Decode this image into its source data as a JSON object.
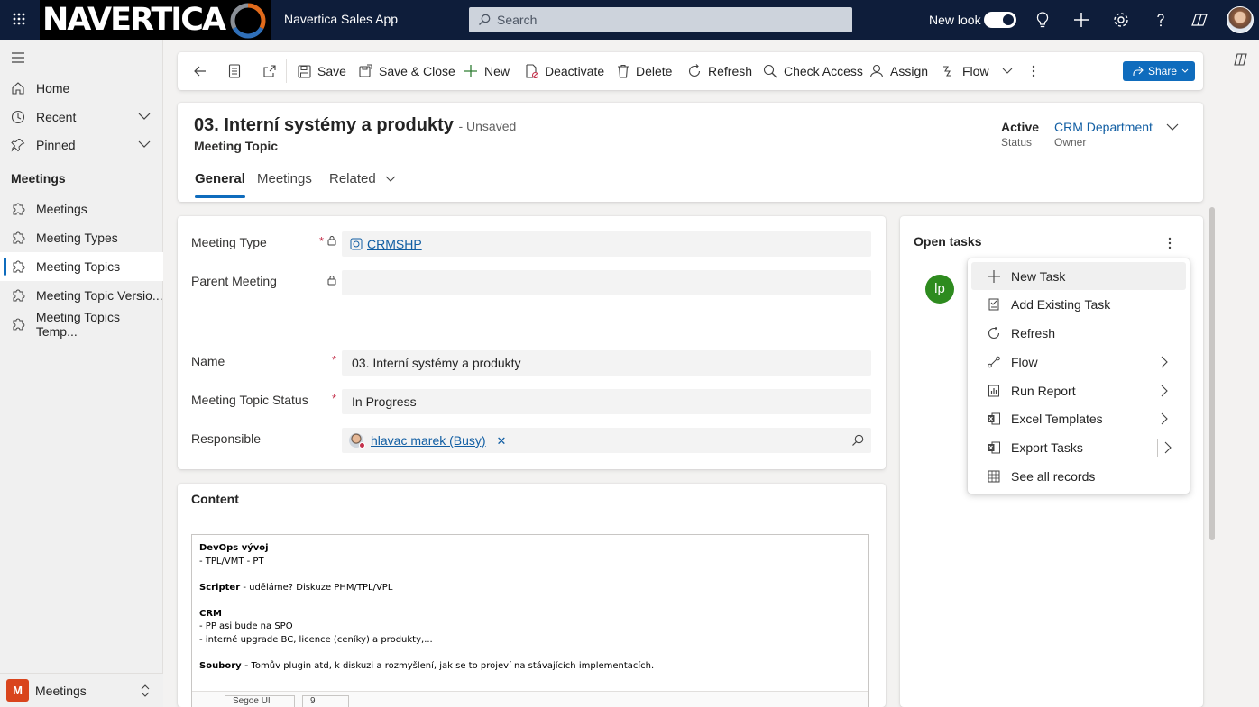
{
  "top_bar": {
    "brand_logo": "NAVERTICA",
    "app_name": "Navertica Sales App",
    "search_placeholder": "Search",
    "new_look_label": "New look",
    "icons": [
      "waffle-icon",
      "lightbulb-icon",
      "plus-icon",
      "gear-icon",
      "help-icon",
      "copilot-icon",
      "user-avatar"
    ]
  },
  "sidebar": {
    "items": [
      {
        "label": "Home",
        "icon": "home-icon"
      },
      {
        "label": "Recent",
        "icon": "clock-icon"
      },
      {
        "label": "Pinned",
        "icon": "pin-icon"
      }
    ],
    "group_title": "Meetings",
    "entities": [
      {
        "label": "Meetings",
        "icon": "puzzle-icon"
      },
      {
        "label": "Meeting Types",
        "icon": "puzzle-icon"
      },
      {
        "label": "Meeting Topics",
        "icon": "puzzle-icon",
        "selected": true
      },
      {
        "label": "Meeting Topic Versio...",
        "icon": "puzzle-icon"
      },
      {
        "label": "Meeting Topics Temp...",
        "icon": "puzzle-icon"
      }
    ],
    "area_badge": "M",
    "area_label": "Meetings"
  },
  "command_bar": {
    "save": "Save",
    "save_close": "Save & Close",
    "new": "New",
    "deactivate": "Deactivate",
    "delete": "Delete",
    "refresh": "Refresh",
    "check_access": "Check Access",
    "assign": "Assign",
    "flow": "Flow",
    "share": "Share"
  },
  "header": {
    "title": "03. Interní systémy a produkty",
    "unsaved": "- Unsaved",
    "entity": "Meeting Topic",
    "status_value": "Active",
    "status_label": "Status",
    "owner_value": "CRM Department",
    "owner_label": "Owner",
    "tabs": [
      "General",
      "Meetings",
      "Related"
    ]
  },
  "form": {
    "meeting_type_label": "Meeting Type",
    "meeting_type_value": "CRMSHP",
    "parent_meeting_label": "Parent Meeting",
    "parent_meeting_value": "",
    "name_label": "Name",
    "name_value": "03. Interní systémy a produkty",
    "status_label": "Meeting Topic Status",
    "status_value": "In Progress",
    "responsible_label": "Responsible",
    "responsible_value": "hlavac marek (Busy)",
    "required_mark": "*"
  },
  "content": {
    "section_title": "Content",
    "lines": [
      {
        "bold": "DevOps vývoj",
        "text": ""
      },
      {
        "bold": "",
        "text": "- TPL/VMT - PT"
      },
      {
        "bold": "",
        "text": ""
      },
      {
        "bold": "Scripter",
        "text": " - uděláme? Diskuze PHM/TPL/VPL"
      },
      {
        "bold": "",
        "text": ""
      },
      {
        "bold": "CRM",
        "text": ""
      },
      {
        "bold": "",
        "text": "- PP asi bude na SPO"
      },
      {
        "bold": "",
        "text": "- interně upgrade BC, licence (ceníky) a produkty,..."
      },
      {
        "bold": "",
        "text": ""
      },
      {
        "bold": "Soubory -",
        "text": " Tomův plugin atd, k diskuzi a rozmyšlení, jak se to projeví na stávajících implementacích."
      }
    ],
    "toolbar_font": "Segoe UI",
    "toolbar_size": "9"
  },
  "tasks": {
    "title": "Open tasks",
    "avatar_initials": "lp"
  },
  "context_menu": {
    "items": [
      {
        "label": "New Task",
        "icon": "plus-icon",
        "submenu": false
      },
      {
        "label": "Add Existing Task",
        "icon": "add-existing-icon",
        "submenu": false
      },
      {
        "label": "Refresh",
        "icon": "refresh-icon",
        "submenu": false
      },
      {
        "label": "Flow",
        "icon": "flow-icon",
        "submenu": true
      },
      {
        "label": "Run Report",
        "icon": "report-icon",
        "submenu": true
      },
      {
        "label": "Excel Templates",
        "icon": "excel-icon",
        "submenu": true
      },
      {
        "label": "Export Tasks",
        "icon": "export-excel-icon",
        "submenu": true
      },
      {
        "label": "See all records",
        "icon": "grid-icon",
        "submenu": false
      }
    ]
  },
  "colors": {
    "top_bar": "#0e1d3a",
    "accent": "#0f6cbd",
    "required": "#c4314b",
    "area_badge": "#d9451d",
    "task_avatar": "#2e8b1f"
  }
}
